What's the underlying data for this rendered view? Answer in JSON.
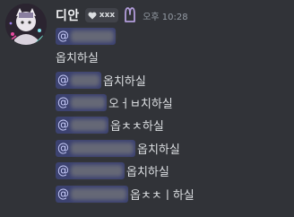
{
  "author": {
    "name": "디안",
    "tag_label": "xxx",
    "timestamp": "오후 10:28"
  },
  "messages": [
    {
      "mention": "@",
      "text": ""
    },
    {
      "mention": "",
      "text": "옵치하실"
    },
    {
      "mention": "@",
      "text": "옵치하실"
    },
    {
      "mention": "@",
      "text": "오ㅓㅂ치하실"
    },
    {
      "mention": "@",
      "text": "옵ㅊㅊ하실"
    },
    {
      "mention": "@",
      "text": "옵치하실"
    },
    {
      "mention": "@",
      "text": "옵치하실"
    },
    {
      "mention": "@",
      "text": "옵ㅊㅊㅣ하실"
    }
  ],
  "colors": {
    "background": "#313338",
    "mention_bg": "#3c4270",
    "mention_text": "#c9cdfb",
    "mod_icon": "#b39ddb"
  }
}
